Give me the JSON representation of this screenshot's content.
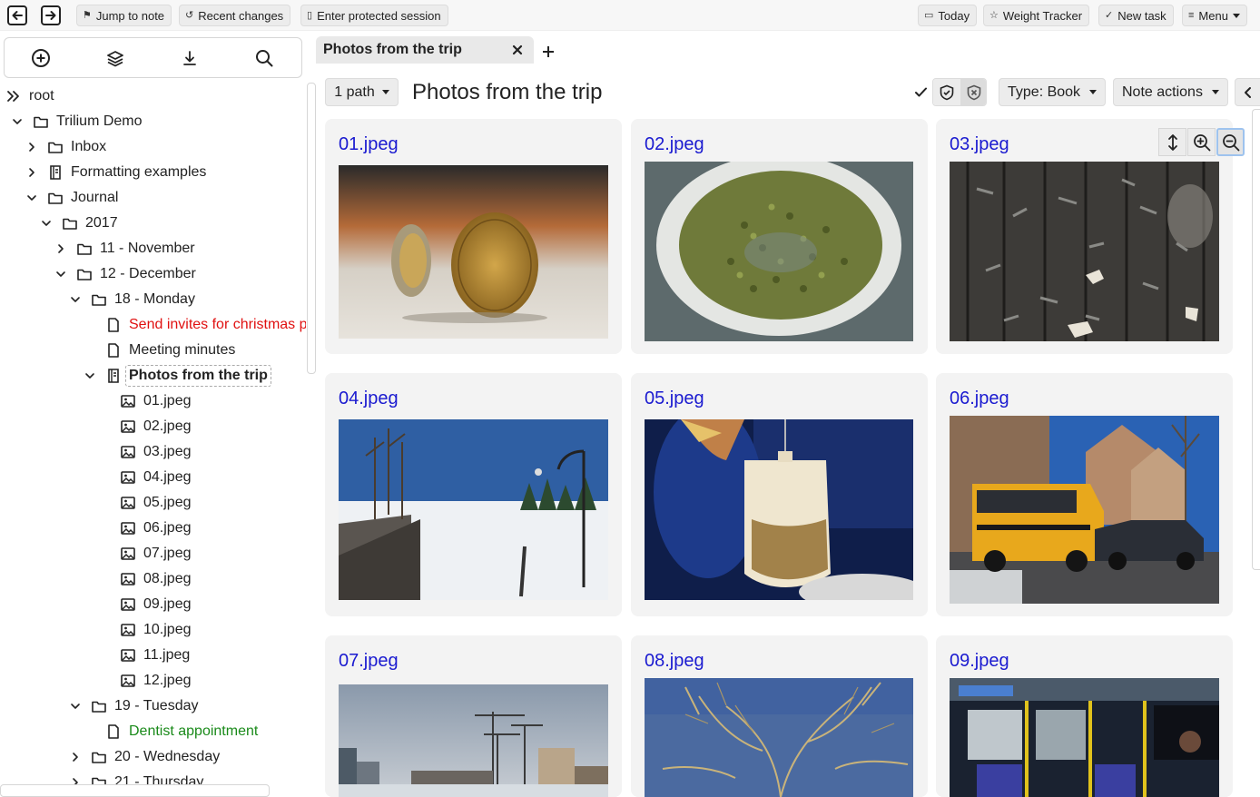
{
  "topbar": {
    "back_icon": "arrow-left-icon",
    "forward_icon": "arrow-right-icon",
    "jump_to_note": "Jump to note",
    "recent_changes": "Recent changes",
    "enter_protected_session": "Enter protected session",
    "today": "Today",
    "weight_tracker": "Weight Tracker",
    "new_task": "New task",
    "menu": "Menu"
  },
  "launcher": {
    "icons": [
      "plus-circle-icon",
      "layers-icon",
      "download-icon",
      "search-icon"
    ]
  },
  "tree": {
    "nodes": [
      {
        "label": "root",
        "icon": "double-chevron-icon",
        "style": "normal"
      },
      {
        "label": "Trilium Demo",
        "icon": "folder-icon",
        "expanded": true,
        "style": "normal"
      },
      {
        "label": "Inbox",
        "icon": "folder-icon",
        "expanded": false,
        "style": "normal"
      },
      {
        "label": "Formatting examples",
        "icon": "book-icon",
        "expanded": false,
        "style": "normal"
      },
      {
        "label": "Journal",
        "icon": "folder-icon",
        "expanded": true,
        "style": "normal"
      },
      {
        "label": "2017",
        "icon": "folder-icon",
        "expanded": true,
        "style": "normal"
      },
      {
        "label": "11 - November",
        "icon": "folder-icon",
        "expanded": false,
        "style": "normal"
      },
      {
        "label": "12 - December",
        "icon": "folder-icon",
        "expanded": true,
        "style": "normal"
      },
      {
        "label": "18 - Monday",
        "icon": "folder-icon",
        "expanded": true,
        "style": "normal"
      },
      {
        "label": "Send invites for christmas party",
        "icon": "file-icon",
        "style": "red"
      },
      {
        "label": "Meeting minutes",
        "icon": "file-icon",
        "style": "normal"
      },
      {
        "label": "Photos from the trip",
        "icon": "book-icon",
        "expanded": true,
        "style": "active"
      },
      {
        "label": "01.jpeg",
        "icon": "image-icon",
        "style": "normal"
      },
      {
        "label": "02.jpeg",
        "icon": "image-icon",
        "style": "normal"
      },
      {
        "label": "03.jpeg",
        "icon": "image-icon",
        "style": "normal"
      },
      {
        "label": "04.jpeg",
        "icon": "image-icon",
        "style": "normal"
      },
      {
        "label": "05.jpeg",
        "icon": "image-icon",
        "style": "normal"
      },
      {
        "label": "06.jpeg",
        "icon": "image-icon",
        "style": "normal"
      },
      {
        "label": "07.jpeg",
        "icon": "image-icon",
        "style": "normal"
      },
      {
        "label": "08.jpeg",
        "icon": "image-icon",
        "style": "normal"
      },
      {
        "label": "09.jpeg",
        "icon": "image-icon",
        "style": "normal"
      },
      {
        "label": "10.jpeg",
        "icon": "image-icon",
        "style": "normal"
      },
      {
        "label": "11.jpeg",
        "icon": "image-icon",
        "style": "normal"
      },
      {
        "label": "12.jpeg",
        "icon": "image-icon",
        "style": "normal"
      },
      {
        "label": "19 - Tuesday",
        "icon": "folder-icon",
        "expanded": true,
        "style": "normal"
      },
      {
        "label": "Dentist appointment",
        "icon": "file-icon",
        "style": "green"
      },
      {
        "label": "20 - Wednesday",
        "icon": "folder-icon",
        "expanded": false,
        "style": "normal"
      },
      {
        "label": "21 - Thursday",
        "icon": "folder-icon",
        "expanded": false,
        "style": "normal"
      }
    ]
  },
  "tab": {
    "title": "Photos from the trip",
    "close_icon": "close-icon",
    "new_tab_icon": "plus-icon"
  },
  "note": {
    "paths": "1 path",
    "title": "Photos from the trip",
    "type": "Type: Book",
    "actions": "Note actions"
  },
  "cards": [
    {
      "title": "01.jpeg",
      "photo": "coins"
    },
    {
      "title": "02.jpeg",
      "photo": "beans-bowl"
    },
    {
      "title": "03.jpeg",
      "photo": "staples-wood"
    },
    {
      "title": "04.jpeg",
      "photo": "frozen-canal"
    },
    {
      "title": "05.jpeg",
      "photo": "tea-bag"
    },
    {
      "title": "06.jpeg",
      "photo": "school-bus"
    },
    {
      "title": "07.jpeg",
      "photo": "construction-cranes"
    },
    {
      "title": "08.jpeg",
      "photo": "bare-branches"
    },
    {
      "title": "09.jpeg",
      "photo": "bus-interior"
    }
  ],
  "zoom_tools": [
    "expand-vertical-icon",
    "zoom-in-icon",
    "zoom-out-icon"
  ],
  "colors": {
    "link": "#1a1ad0",
    "highlight_red": "#e01010",
    "highlight_green": "#1a8a1a"
  }
}
